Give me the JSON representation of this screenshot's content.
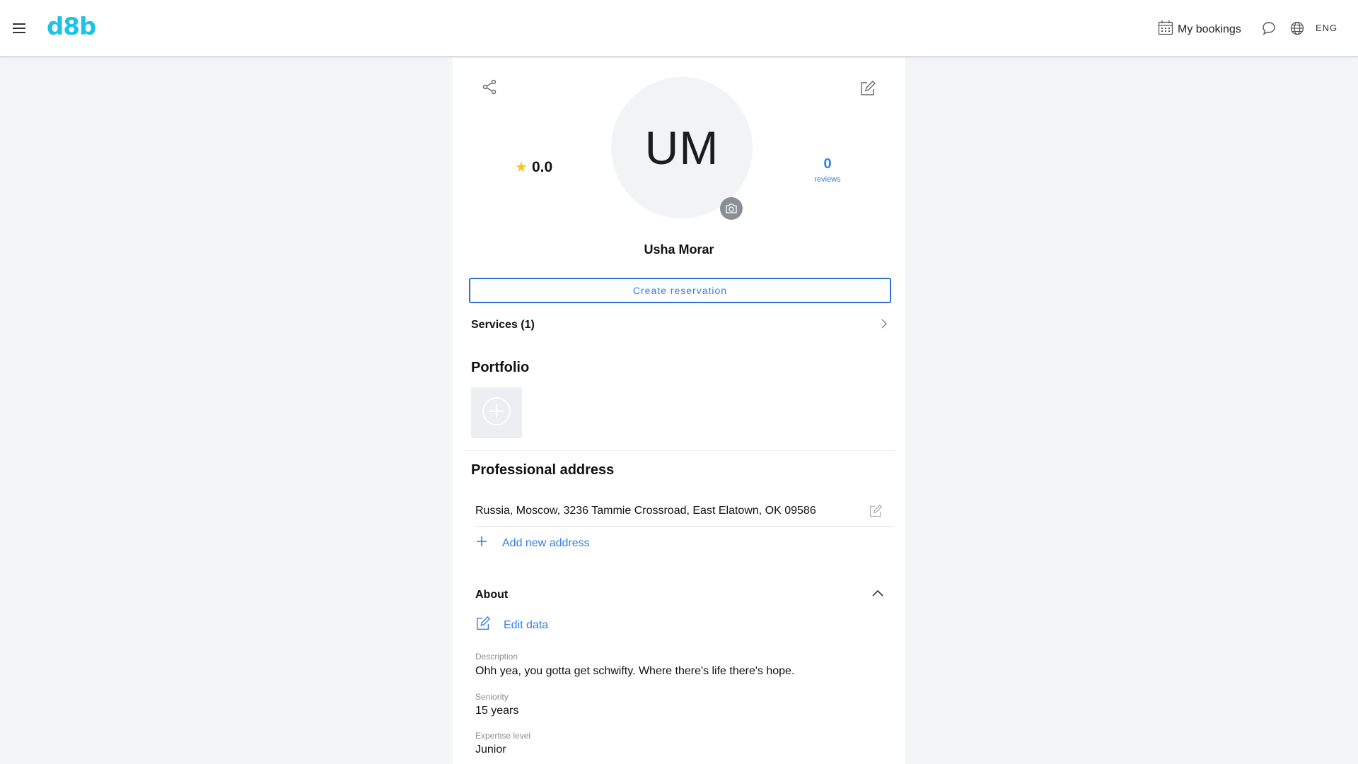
{
  "header": {
    "logo": "d8b",
    "bookings_label": "My bookings",
    "language": "ENG"
  },
  "profile": {
    "initials": "UM",
    "name": "Usha Morar",
    "rating": "0.0",
    "reviews_count": "0",
    "reviews_label": "reviews",
    "create_reservation_label": "Create reservation",
    "services_label": "Services (1)"
  },
  "portfolio": {
    "title": "Portfolio"
  },
  "address": {
    "title": "Professional address",
    "items": [
      "Russia, Moscow, 3236 Tammie Crossroad, East Elatown, OK 09586"
    ],
    "add_label": "Add new address"
  },
  "about": {
    "title": "About",
    "edit_label": "Edit data",
    "fields": [
      {
        "label": "Description",
        "value": "Ohh yea, you gotta get schwifty. Where there's life there's hope."
      },
      {
        "label": "Seniority",
        "value": "15 years"
      },
      {
        "label": "Expertise level",
        "value": "Junior"
      }
    ]
  },
  "colors": {
    "brand": "#1ec2e6",
    "link": "#2f80ed",
    "star": "#f5c518",
    "background": "#f3f5f8"
  },
  "icons": [
    "menu-icon",
    "calendar-icon",
    "chat-icon",
    "globe-icon",
    "share-icon",
    "edit-icon",
    "camera-icon",
    "star-icon",
    "chevron-right-icon",
    "plus-circle-icon",
    "plus-icon",
    "chevron-up-icon"
  ]
}
